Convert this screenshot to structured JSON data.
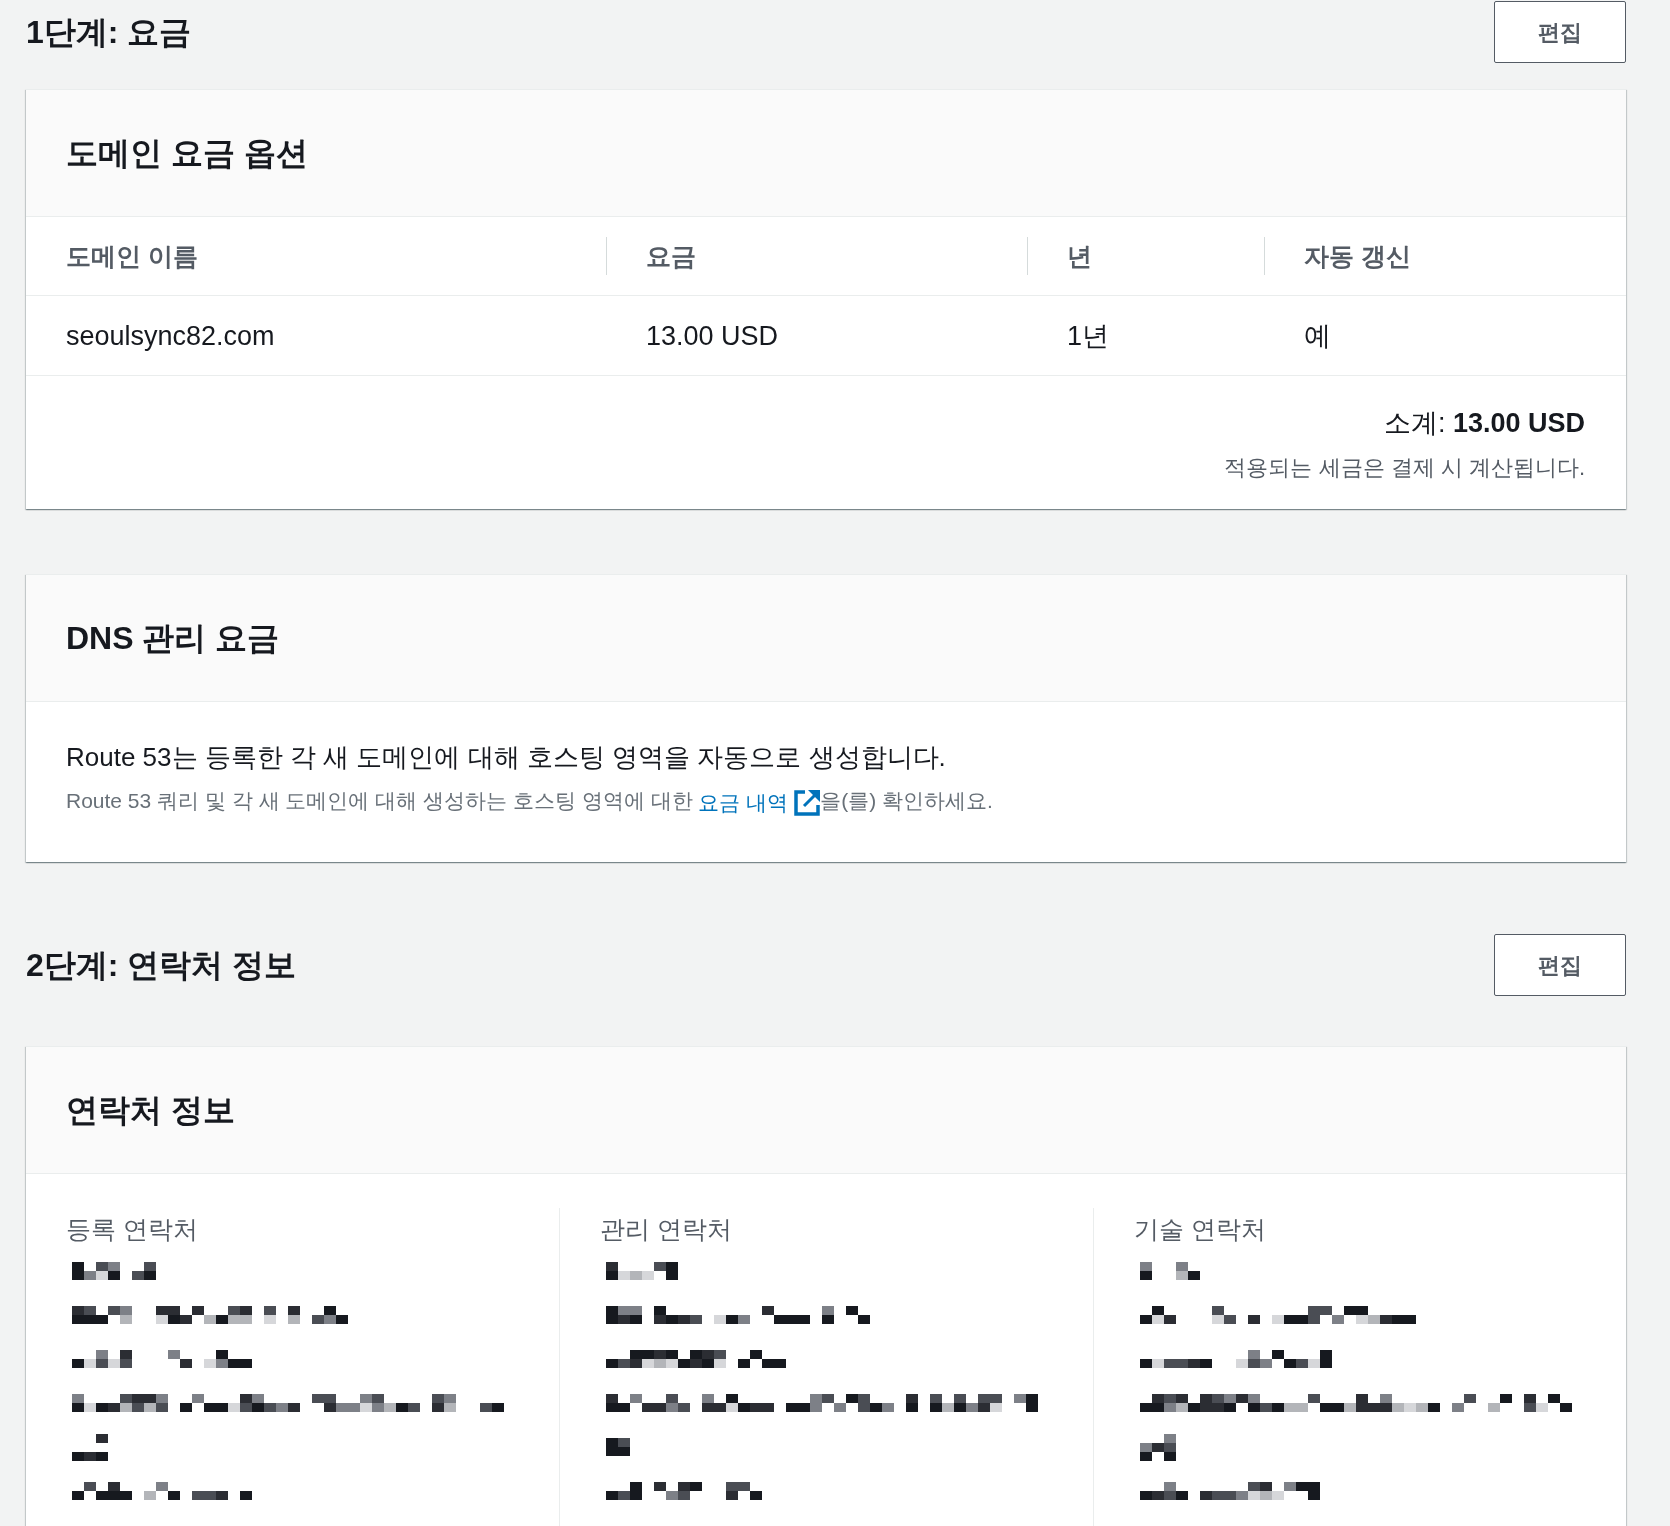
{
  "sections": [
    {
      "heading": "1단계: 요금",
      "edit_label": "편집",
      "cards": [
        {
          "kind": "table",
          "title": "도메인 요금 옵션",
          "columns": [
            "도메인 이름",
            "요금",
            "년",
            "자동 갱신"
          ],
          "rows": [
            [
              "seoulsync82.com",
              "13.00 USD",
              "1년",
              "예"
            ]
          ],
          "subtotal": "소계: **13.00 USD**",
          "subtotal_note": "적용되는 세금은 결제 시 계산됩니다."
        },
        {
          "kind": "info",
          "title": "DNS 관리 요금",
          "description": "Route 53는 등록한 각 새 도메인에 대해 호스팅 영역을 자동으로 생성합니다.",
          "note": {
            "before": "Route 53 쿼리 및 각 새 도메인에 대해 생성하는 호스팅 영역에 대한",
            "link": "요금 내역",
            "after": "을(를) 확인하세요."
          }
        }
      ]
    },
    {
      "heading": "2단계: 연락처 정보",
      "edit_label": "편집",
      "cards": [
        {
          "kind": "contacts",
          "title": "연락처 정보",
          "contacts": [
            {
              "label": "등록 연락처",
              "lines": [
                {
                  "kind": "redacted"
                },
                {
                  "kind": "redacted"
                },
                {
                  "kind": "redacted"
                },
                {
                  "kind": "redacted"
                },
                {
                  "kind": "redacted"
                },
                {
                  "kind": "redacted"
                }
              ]
            },
            {
              "label": "관리 연락처",
              "lines": [
                {
                  "kind": "redacted"
                },
                {
                  "kind": "redacted"
                },
                {
                  "kind": "redacted"
                },
                {
                  "kind": "redacted"
                },
                {
                  "kind": "redacted"
                },
                {
                  "kind": "redacted"
                }
              ]
            },
            {
              "label": "기술 연락처",
              "lines": [
                {
                  "kind": "redacted"
                },
                {
                  "kind": "redacted"
                },
                {
                  "kind": "redacted"
                },
                {
                  "kind": "redacted"
                },
                {
                  "kind": "redacted"
                },
                {
                  "kind": "redacted"
                }
              ]
            }
          ]
        }
      ]
    }
  ]
}
